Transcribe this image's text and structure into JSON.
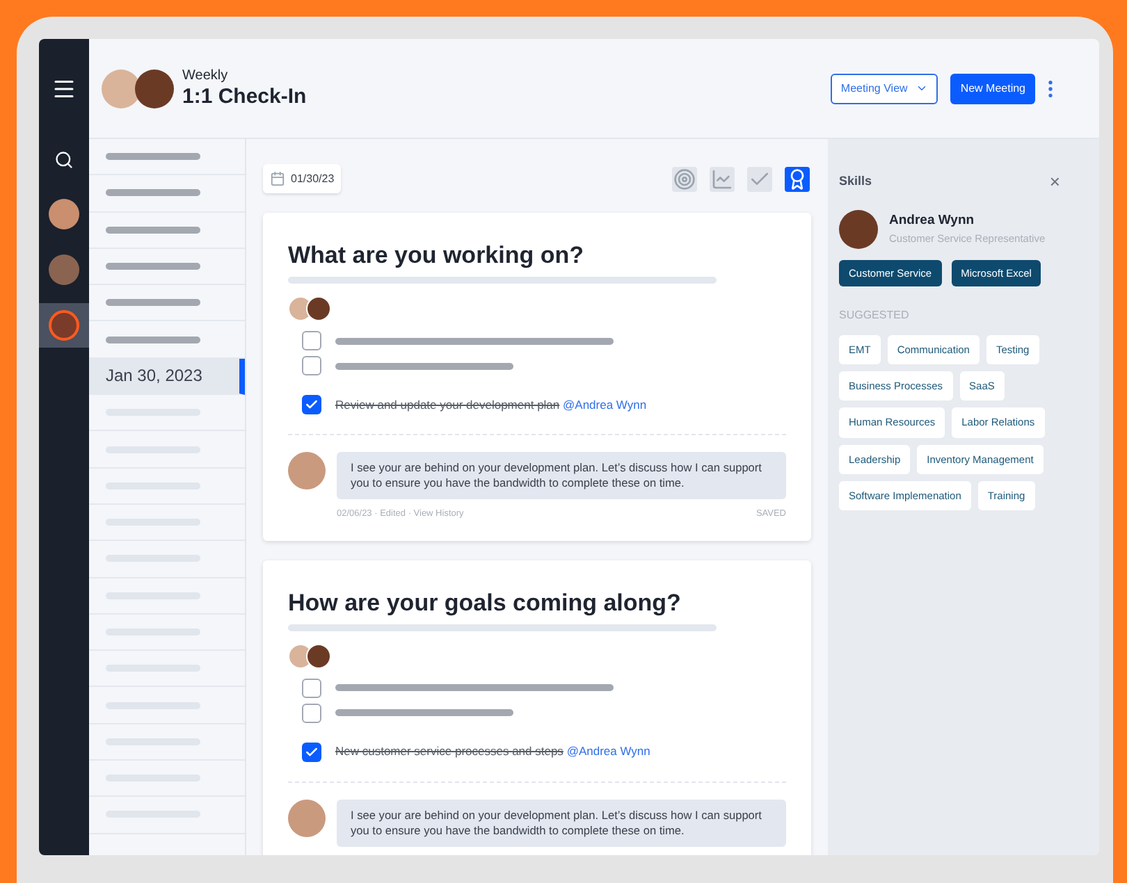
{
  "rail": {
    "avatars": [
      {
        "selected": false
      },
      {
        "selected": false
      },
      {
        "selected": true
      }
    ]
  },
  "header": {
    "subtitle": "Weekly",
    "title": "1:1 Check-In",
    "view_button": "Meeting View",
    "new_button": "New Meeting"
  },
  "date_list": [
    {
      "kind": "past",
      "selected": false
    },
    {
      "kind": "past",
      "selected": false
    },
    {
      "kind": "past",
      "selected": false
    },
    {
      "kind": "past",
      "selected": false
    },
    {
      "kind": "past",
      "selected": false
    },
    {
      "kind": "past",
      "selected": false
    },
    {
      "kind": "date",
      "label": "Jan 30, 2023",
      "selected": true
    },
    {
      "kind": "future",
      "selected": false
    },
    {
      "kind": "future",
      "selected": false
    },
    {
      "kind": "future",
      "selected": false
    },
    {
      "kind": "future",
      "selected": false
    },
    {
      "kind": "future",
      "selected": false
    },
    {
      "kind": "future",
      "selected": false
    },
    {
      "kind": "future",
      "selected": false
    },
    {
      "kind": "future",
      "selected": false
    },
    {
      "kind": "future",
      "selected": false
    },
    {
      "kind": "future",
      "selected": false
    },
    {
      "kind": "future",
      "selected": false
    },
    {
      "kind": "future",
      "selected": false
    }
  ],
  "toolbar": {
    "date": "01/30/23",
    "views": [
      {
        "kind": "target",
        "selected": false
      },
      {
        "kind": "chart",
        "selected": false
      },
      {
        "kind": "check",
        "selected": false
      },
      {
        "kind": "award",
        "selected": true
      }
    ]
  },
  "cards": [
    {
      "title": "What are you working on?",
      "tasks": [
        {
          "checked": false
        },
        {
          "checked": false
        },
        {
          "checked": true,
          "text": "Review and update your development plan",
          "mention": "@Andrea Wynn"
        }
      ],
      "comment": "I see your are behind on your development plan. Let’s discuss how I can support you to ensure you have the bandwidth to complete these on time.",
      "meta": "02/06/23 · Edited · View History",
      "status": "SAVED"
    },
    {
      "title": "How are your goals coming along?",
      "tasks": [
        {
          "checked": false
        },
        {
          "checked": false
        },
        {
          "checked": true,
          "text": "New customer service processes and steps",
          "mention": "@Andrea Wynn"
        }
      ],
      "comment": "I see your are behind on your development plan. Let’s discuss how I can support you to ensure you have the bandwidth to complete these on time."
    }
  ],
  "skills": {
    "title": "Skills",
    "close": "×",
    "name": "Andrea Wynn",
    "role": "Customer Service Representative",
    "current": [
      "Customer Service",
      "Microsoft Excel"
    ],
    "suggested_label": "SUGGESTED",
    "suggested": [
      "EMT",
      "Communication",
      "Testing",
      "Business Processes",
      "SaaS",
      "Human Resources",
      "Labor Relations",
      "Leadership",
      "Inventory Management",
      "Software Implemenation",
      "Training"
    ]
  }
}
